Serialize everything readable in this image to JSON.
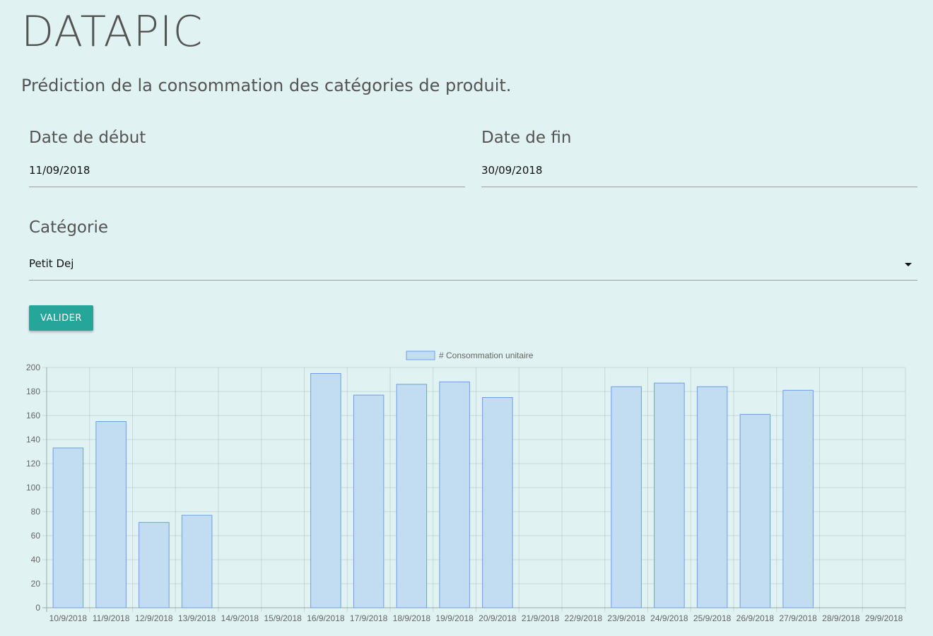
{
  "header": {
    "title": "DATAPIC",
    "subtitle": "Prédiction de la consommation des catégories de produit."
  },
  "form": {
    "start_label": "Date de début",
    "start_value": "11/09/2018",
    "end_label": "Date de fin",
    "end_value": "30/09/2018",
    "category_label": "Catégorie",
    "category_value": "Petit Dej",
    "submit_label": "VALIDER"
  },
  "colors": {
    "background": "#e0f2f1",
    "button": "#26a69a",
    "bar_fill": "#c2dcf2",
    "bar_border": "#6d9eeb"
  },
  "chart_data": {
    "type": "bar",
    "legend": "# Consommation unitaire",
    "legend_position": "top-center",
    "grid": true,
    "ylim": [
      0,
      200
    ],
    "yticks": [
      "0",
      "20",
      "40",
      "60",
      "80",
      "100",
      "120",
      "140",
      "160",
      "180",
      "200"
    ],
    "categories": [
      "10/9/2018",
      "11/9/2018",
      "12/9/2018",
      "13/9/2018",
      "14/9/2018",
      "15/9/2018",
      "16/9/2018",
      "17/9/2018",
      "18/9/2018",
      "19/9/2018",
      "20/9/2018",
      "21/9/2018",
      "22/9/2018",
      "23/9/2018",
      "24/9/2018",
      "25/9/2018",
      "26/9/2018",
      "27/9/2018",
      "28/9/2018",
      "29/9/2018"
    ],
    "values": [
      133,
      155,
      71,
      77,
      0,
      0,
      195,
      177,
      186,
      188,
      175,
      0,
      0,
      184,
      187,
      184,
      161,
      181,
      0,
      0
    ]
  }
}
